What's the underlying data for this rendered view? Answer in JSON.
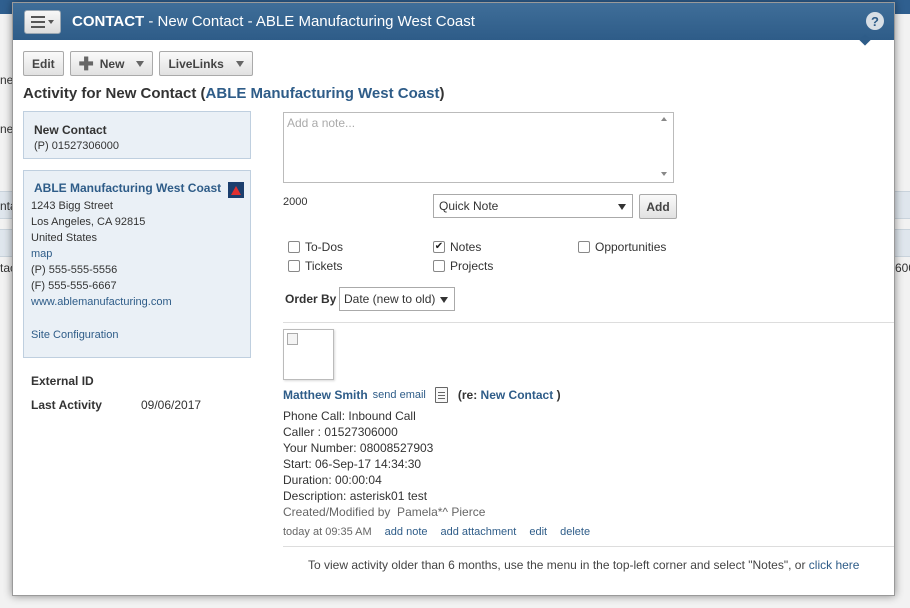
{
  "background": {
    "fragments": [
      "ne",
      "ne",
      "nta",
      "tac",
      "600"
    ]
  },
  "modal": {
    "title_bold": "CONTACT",
    "title_rest": " - New Contact - ABLE Manufacturing West Coast",
    "help": "?"
  },
  "toolbar": {
    "edit": "Edit",
    "new": "New",
    "livelinks": "LiveLinks"
  },
  "activity": {
    "prefix": "Activity for New Contact (",
    "company_link": "ABLE Manufacturing West Coast",
    "suffix": ")"
  },
  "contact": {
    "name": "New Contact",
    "phone": "(P) 01527306000"
  },
  "company": {
    "name": "ABLE Manufacturing West Coast",
    "address1": "1243 Bigg Street",
    "address2": "Los Angeles, CA 92815",
    "country": "United States",
    "map": "map",
    "phone": "(P) 555-555-5556",
    "fax": "(F) 555-555-6667",
    "website": "www.ablemanufacturing.com",
    "site_config": "Site Configuration"
  },
  "details": {
    "external_id_label": "External ID",
    "last_activity_label": "Last Activity",
    "last_activity_value": "09/06/2017"
  },
  "note": {
    "placeholder": "Add a note...",
    "char_count": "2000",
    "type": "Quick Note",
    "add": "Add"
  },
  "filters": [
    {
      "label": "To-Dos",
      "checked": false
    },
    {
      "label": "Notes",
      "checked": true
    },
    {
      "label": "Opportunities",
      "checked": false
    },
    {
      "label": "Tickets",
      "checked": false
    },
    {
      "label": "Projects",
      "checked": false
    }
  ],
  "order": {
    "label": "Order By",
    "value": "Date (new to old)"
  },
  "entry": {
    "author": "Matthew Smith",
    "send_email": "send email",
    "re_prefix": "(re: ",
    "re_link": "New Contact",
    "re_suffix": " )",
    "lines": [
      "Phone Call: Inbound Call",
      "Caller : 01527306000",
      "Your Number: 08008527903",
      "Start: 06-Sep-17 14:34:30",
      "Duration: 00:00:04",
      "Description: asterisk01 test"
    ],
    "created": "Created/Modified by  Pamela*^ Pierce",
    "timestamp": "today at 09:35 AM",
    "add_note": "add note",
    "add_attachment": "add attachment",
    "edit": "edit",
    "delete": "delete"
  },
  "footer": {
    "text": "To view activity older than 6 months, use the menu in the top-left corner and select \"Notes\", or ",
    "link": "click here"
  }
}
